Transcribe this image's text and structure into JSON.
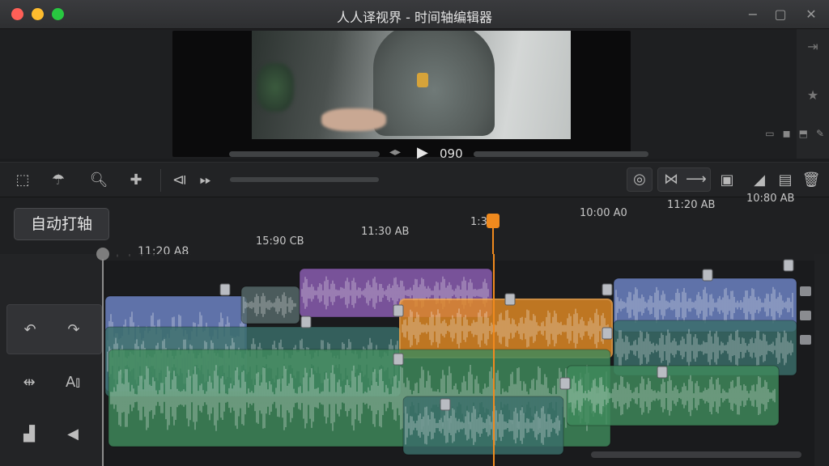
{
  "window": {
    "title": "人人译视界 - 时间轴编辑器",
    "controls": [
      "−",
      "▢",
      "✕"
    ]
  },
  "transport": {
    "timecode": "090"
  },
  "toolbar": {
    "left_icons": [
      "selection-tool",
      "blade-tool",
      "zoom-tool",
      "position-tool"
    ],
    "playback_icons": [
      "mark-in",
      "fast-forward"
    ]
  },
  "timeline": {
    "auto_button_label": "自动打轴",
    "ruler_row1": [
      "15:90 CB",
      "11:30 AB",
      "1:3",
      "10:00 A0",
      "11:20 AB",
      "10:80 AB"
    ],
    "ruler_row2": [
      "11:20 A8"
    ],
    "playhead_color": "#f08a1e"
  },
  "colors": {
    "blue_clip": "#6f86c8",
    "purple_clip": "#8d5fb5",
    "orange_clip": "#e38a24",
    "teal_clip": "#3a6e6a",
    "green_clip": "#3f8a5c"
  }
}
